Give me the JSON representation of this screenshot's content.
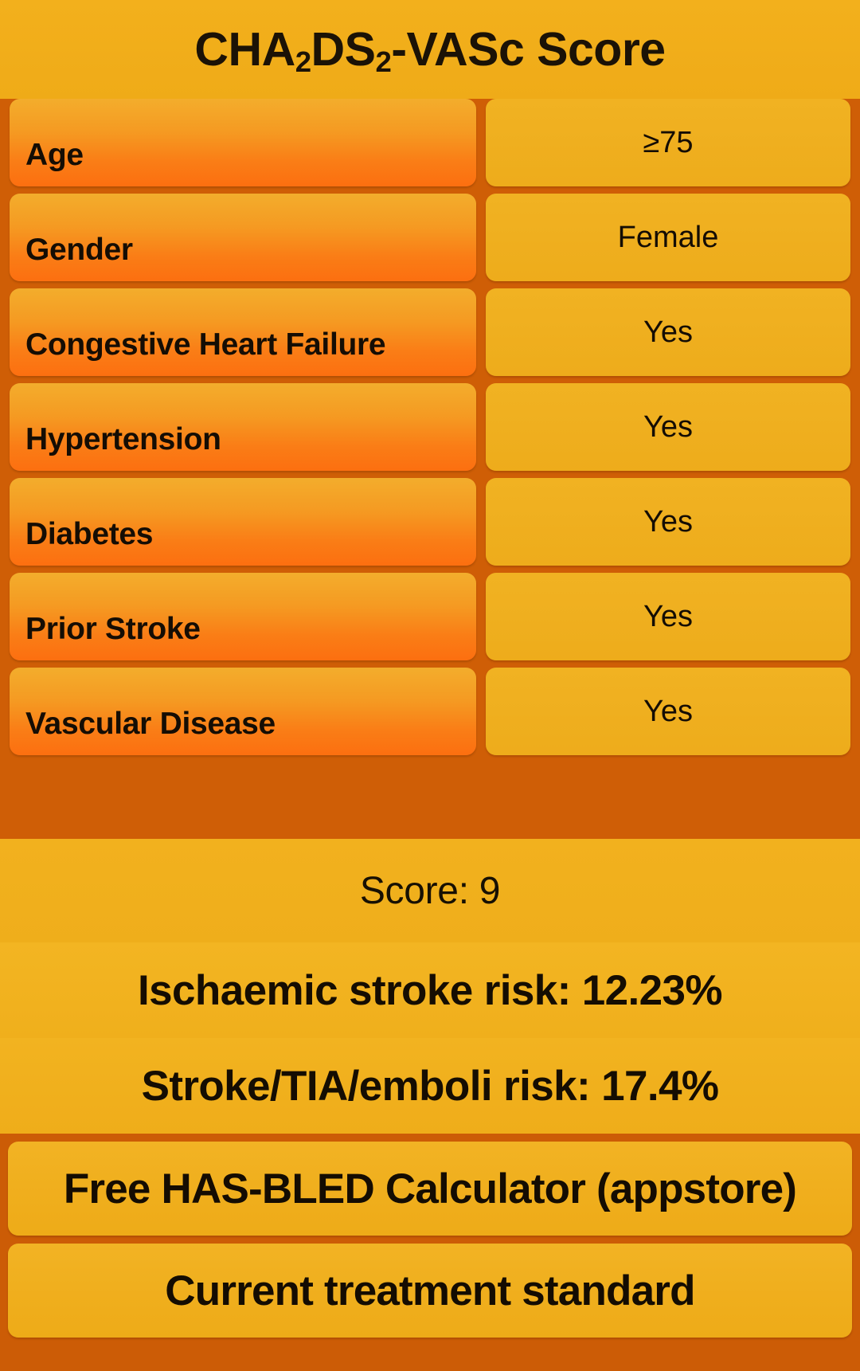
{
  "header": {
    "title_prefix": "CHA",
    "title_sub1": "2",
    "title_mid": "DS",
    "title_sub2": "2",
    "title_suffix": "-VASc Score",
    "title_plain": "CHA2DS2-VASc Score"
  },
  "criteria": [
    {
      "label": "Age",
      "value": "≥75"
    },
    {
      "label": "Gender",
      "value": "Female"
    },
    {
      "label": "Congestive Heart Failure",
      "value": "Yes"
    },
    {
      "label": "Hypertension",
      "value": "Yes"
    },
    {
      "label": "Diabetes",
      "value": "Yes"
    },
    {
      "label": "Prior Stroke",
      "value": "Yes"
    },
    {
      "label": "Vascular Disease",
      "value": "Yes"
    }
  ],
  "results": {
    "score": "Score: 9",
    "ischaemic_stroke_risk": "Ischaemic stroke risk: 12.23%",
    "stroke_tia_emboli_risk": "Stroke/TIA/emboli risk: 17.4%"
  },
  "actions": [
    {
      "label": "Free HAS-BLED Calculator (appstore)"
    },
    {
      "label": "Current treatment standard"
    }
  ],
  "colors": {
    "background": "#cf5e06",
    "band_amber": "#f0af1c",
    "label_top": "#f3ad2c",
    "label_bottom": "#fc6f10",
    "text": "#150d04"
  }
}
